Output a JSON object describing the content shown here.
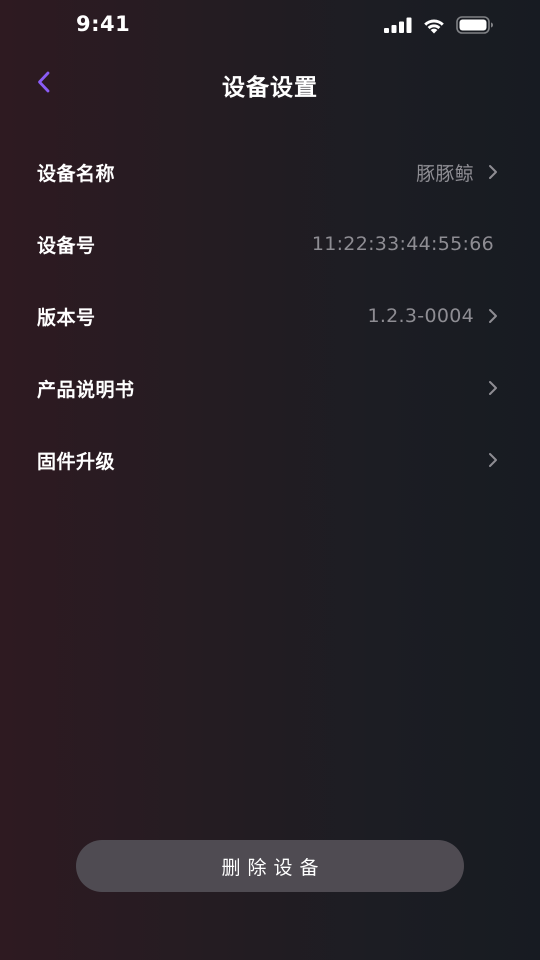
{
  "status_bar": {
    "time": "9:41",
    "icons": [
      "cellular-signal-icon",
      "wifi-icon",
      "battery-icon"
    ]
  },
  "nav": {
    "title": "设备设置",
    "back_icon": "chevron-left-icon",
    "accent_color": "#8a5cf6"
  },
  "settings": [
    {
      "label": "设备名称",
      "value": "豚豚鲸",
      "has_chevron": true
    },
    {
      "label": "设备号",
      "value": "11:22:33:44:55:66",
      "has_chevron": false
    },
    {
      "label": "版本号",
      "value": "1.2.3-0004",
      "has_chevron": true
    },
    {
      "label": "产品说明书",
      "value": "",
      "has_chevron": true
    },
    {
      "label": "固件升级",
      "value": "",
      "has_chevron": true
    }
  ],
  "footer": {
    "delete_label": "删除设备"
  }
}
